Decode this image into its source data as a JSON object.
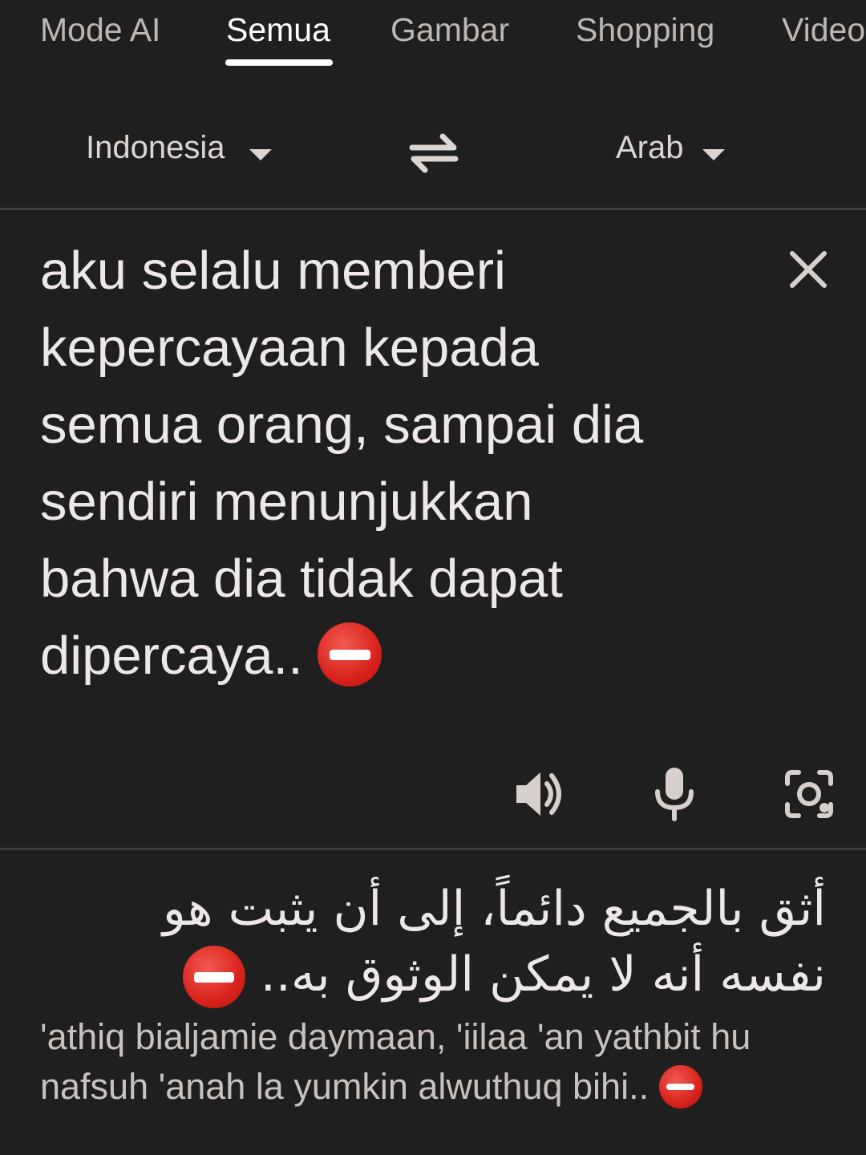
{
  "tabs": [
    {
      "label": "Mode AI",
      "active": false
    },
    {
      "label": "Semua",
      "active": true
    },
    {
      "label": "Gambar",
      "active": false
    },
    {
      "label": "Shopping",
      "active": false
    },
    {
      "label": "Video",
      "active": false
    }
  ],
  "translator": {
    "source_language": "Indonesia",
    "target_language": "Arab",
    "source_text": "aku selalu memberi\nkepercayaan kepada\nsemua orang, sampai dia\nsendiri menunjukkan\nbahwa dia tidak dapat\ndipercaya..",
    "translation_arabic": "أثق بالجميع دائماً، إلى أن يثبت هو نفسه أنه لا يمكن الوثوق به..",
    "transliteration": "'athiq bialjamie daymaan, 'iilaa 'an yathbit hu nafsuh 'anah la yumkin alwuthuq bihi..",
    "emoji": "no-entry-emoji"
  },
  "icons": {
    "swap": "swap-arrows-icon",
    "clear": "close-icon",
    "listen": "speaker-icon",
    "mic": "microphone-icon",
    "camera": "camera-lens-icon"
  },
  "colors": {
    "background": "#1f1f1f",
    "text_primary": "#ede7e7",
    "text_secondary": "#bdb6b2",
    "divider": "#3c3c3c",
    "emoji_red": "#d8231c"
  }
}
